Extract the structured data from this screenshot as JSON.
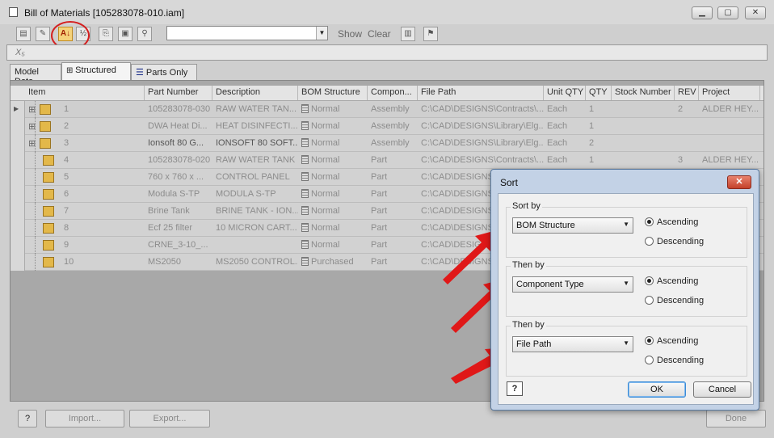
{
  "window": {
    "title": "Bill of Materials [105283078-010.iam]",
    "controls": [
      "minimize",
      "restore",
      "close"
    ]
  },
  "toolbar": {
    "search_value": "",
    "show_label": "Show",
    "clear_label": "Clear"
  },
  "formula_bar": {
    "symbol": "X₅",
    "value": ""
  },
  "tabs": [
    {
      "label": "Model Data",
      "active": false
    },
    {
      "label": "Structured",
      "active": true
    },
    {
      "label": "Parts Only",
      "active": false
    }
  ],
  "table": {
    "columns": [
      "Item",
      "Part Number",
      "Description",
      "BOM Structure",
      "Compon...",
      "File Path",
      "Unit QTY",
      "QTY",
      "Stock Number",
      "REV",
      "Project"
    ],
    "rows": [
      {
        "item": "1",
        "part_number": "105283078-030",
        "description": "RAW WATER TAN...",
        "bom": "Normal",
        "component": "Assembly",
        "file_path": "C:\\CAD\\DESIGNS\\Contracts\\...",
        "unit_qty": "Each",
        "qty": "1",
        "stock": "",
        "rev": "2",
        "project": "ALDER HEY..."
      },
      {
        "item": "2",
        "part_number": "DWA Heat Di...",
        "description": "HEAT DISINFECTI...",
        "bom": "Normal",
        "component": "Assembly",
        "file_path": "C:\\CAD\\DESIGNS\\Library\\Elg...",
        "unit_qty": "Each",
        "qty": "1",
        "stock": "",
        "rev": "",
        "project": ""
      },
      {
        "item": "3",
        "part_number": "Ionsoft 80 G...",
        "description": "IONSOFT 80 SOFT...",
        "bom": "Normal",
        "component": "Assembly",
        "file_path": "C:\\CAD\\DESIGNS\\Library\\Elg...",
        "unit_qty": "Each",
        "qty": "2",
        "stock": "",
        "rev": "",
        "project": ""
      },
      {
        "item": "4",
        "part_number": "105283078-020",
        "description": "RAW WATER TANK",
        "bom": "Normal",
        "component": "Part",
        "file_path": "C:\\CAD\\DESIGNS\\Contracts\\...",
        "unit_qty": "Each",
        "qty": "1",
        "stock": "",
        "rev": "3",
        "project": "ALDER HEY..."
      },
      {
        "item": "5",
        "part_number": "760 x 760 x ...",
        "description": "CONTROL PANEL",
        "bom": "Normal",
        "component": "Part",
        "file_path": "C:\\CAD\\DESIGNS",
        "unit_qty": "",
        "qty": "",
        "stock": "",
        "rev": "",
        "project": ""
      },
      {
        "item": "6",
        "part_number": "Modula S-TP",
        "description": "MODULA S-TP",
        "bom": "Normal",
        "component": "Part",
        "file_path": "C:\\CAD\\DESIGNS",
        "unit_qty": "",
        "qty": "",
        "stock": "",
        "rev": "",
        "project": ""
      },
      {
        "item": "7",
        "part_number": "Brine Tank",
        "description": "BRINE TANK - ION...",
        "bom": "Normal",
        "component": "Part",
        "file_path": "C:\\CAD\\DESIGNS",
        "unit_qty": "",
        "qty": "",
        "stock": "",
        "rev": "",
        "project": ""
      },
      {
        "item": "8",
        "part_number": "Ecf 25 filter",
        "description": "10 MICRON CART...",
        "bom": "Normal",
        "component": "Part",
        "file_path": "C:\\CAD\\DESIGNS",
        "unit_qty": "",
        "qty": "",
        "stock": "",
        "rev": "",
        "project": ""
      },
      {
        "item": "9",
        "part_number": "CRNE_3-10_...",
        "description": "",
        "bom": "Normal",
        "component": "Part",
        "file_path": "C:\\CAD\\DESIGNS",
        "unit_qty": "",
        "qty": "",
        "stock": "",
        "rev": "",
        "project": ""
      },
      {
        "item": "10",
        "part_number": "MS2050",
        "description": "MS2050 CONTROL...",
        "bom": "Purchased",
        "component": "Part",
        "file_path": "C:\\CAD\\DESIGNS",
        "unit_qty": "",
        "qty": "",
        "stock": "",
        "rev": "",
        "project": ""
      }
    ]
  },
  "footer": {
    "import_label": "Import...",
    "export_label": "Export...",
    "done_label": "Done"
  },
  "sort_dialog": {
    "title": "Sort",
    "groups": [
      {
        "label": "Sort by",
        "value": "BOM Structure",
        "ascending_label": "Ascending",
        "descending_label": "Descending",
        "selected": "Ascending"
      },
      {
        "label": "Then by",
        "value": "Component Type",
        "ascending_label": "Ascending",
        "descending_label": "Descending",
        "selected": "Ascending"
      },
      {
        "label": "Then by",
        "value": "File Path",
        "ascending_label": "Ascending",
        "descending_label": "Descending",
        "selected": "Ascending"
      }
    ],
    "ok_label": "OK",
    "cancel_label": "Cancel",
    "help_symbol": "?"
  },
  "colors": {
    "arrow": "#e01818",
    "highlight_circle": "#d42020"
  }
}
